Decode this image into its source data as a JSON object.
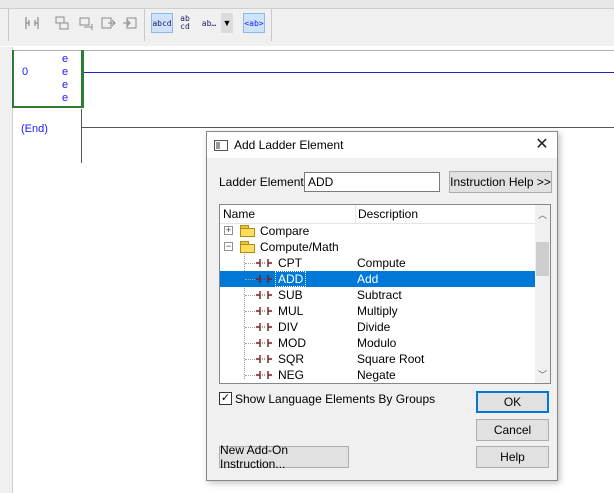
{
  "toolbar": {
    "buttons": [
      {
        "icon": "rung-icon",
        "label": ""
      },
      {
        "icon": "branch-icon",
        "label": ""
      },
      {
        "icon": "branch-level-icon",
        "label": ""
      },
      {
        "icon": "export-icon",
        "label": ""
      },
      {
        "icon": "import-icon",
        "label": ""
      },
      {
        "icon": "text-format-icon",
        "label": "abcd"
      },
      {
        "icon": "text-stacked-icon",
        "label": "ab\ncd"
      },
      {
        "icon": "text-ellipsis-icon",
        "label": "ab…"
      },
      {
        "icon": "tag-icon",
        "label": "<ab>"
      }
    ]
  },
  "editor": {
    "rung_number": "0",
    "e_marks": [
      "e",
      "e",
      "e",
      "e"
    ],
    "end_label": "(End)"
  },
  "dialog": {
    "title": "Add Ladder Element",
    "ladder_element_label": "Ladder Element:",
    "ladder_element_value": "ADD",
    "instruction_help_label": "Instruction Help >>",
    "columns": {
      "name": "Name",
      "description": "Description"
    },
    "folders": [
      {
        "name": "Compare",
        "expanded": false
      },
      {
        "name": "Compute/Math",
        "expanded": true
      }
    ],
    "instructions": [
      {
        "name": "CPT",
        "description": "Compute",
        "selected": false
      },
      {
        "name": "ADD",
        "description": "Add",
        "selected": true
      },
      {
        "name": "SUB",
        "description": "Subtract",
        "selected": false
      },
      {
        "name": "MUL",
        "description": "Multiply",
        "selected": false
      },
      {
        "name": "DIV",
        "description": "Divide",
        "selected": false
      },
      {
        "name": "MOD",
        "description": "Modulo",
        "selected": false
      },
      {
        "name": "SQR",
        "description": "Square Root",
        "selected": false
      },
      {
        "name": "NEG",
        "description": "Negate",
        "selected": false
      }
    ],
    "show_groups_label": "Show Language Elements By Groups",
    "show_groups_checked": true,
    "ok_label": "OK",
    "cancel_label": "Cancel",
    "help_label": "Help",
    "new_aoi_label": "New Add-On Instruction...",
    "colors": {
      "selection": "#0078d7",
      "rung": "#2e7d32",
      "wire": "#2222cc",
      "text_blue": "#1a1aff"
    }
  }
}
